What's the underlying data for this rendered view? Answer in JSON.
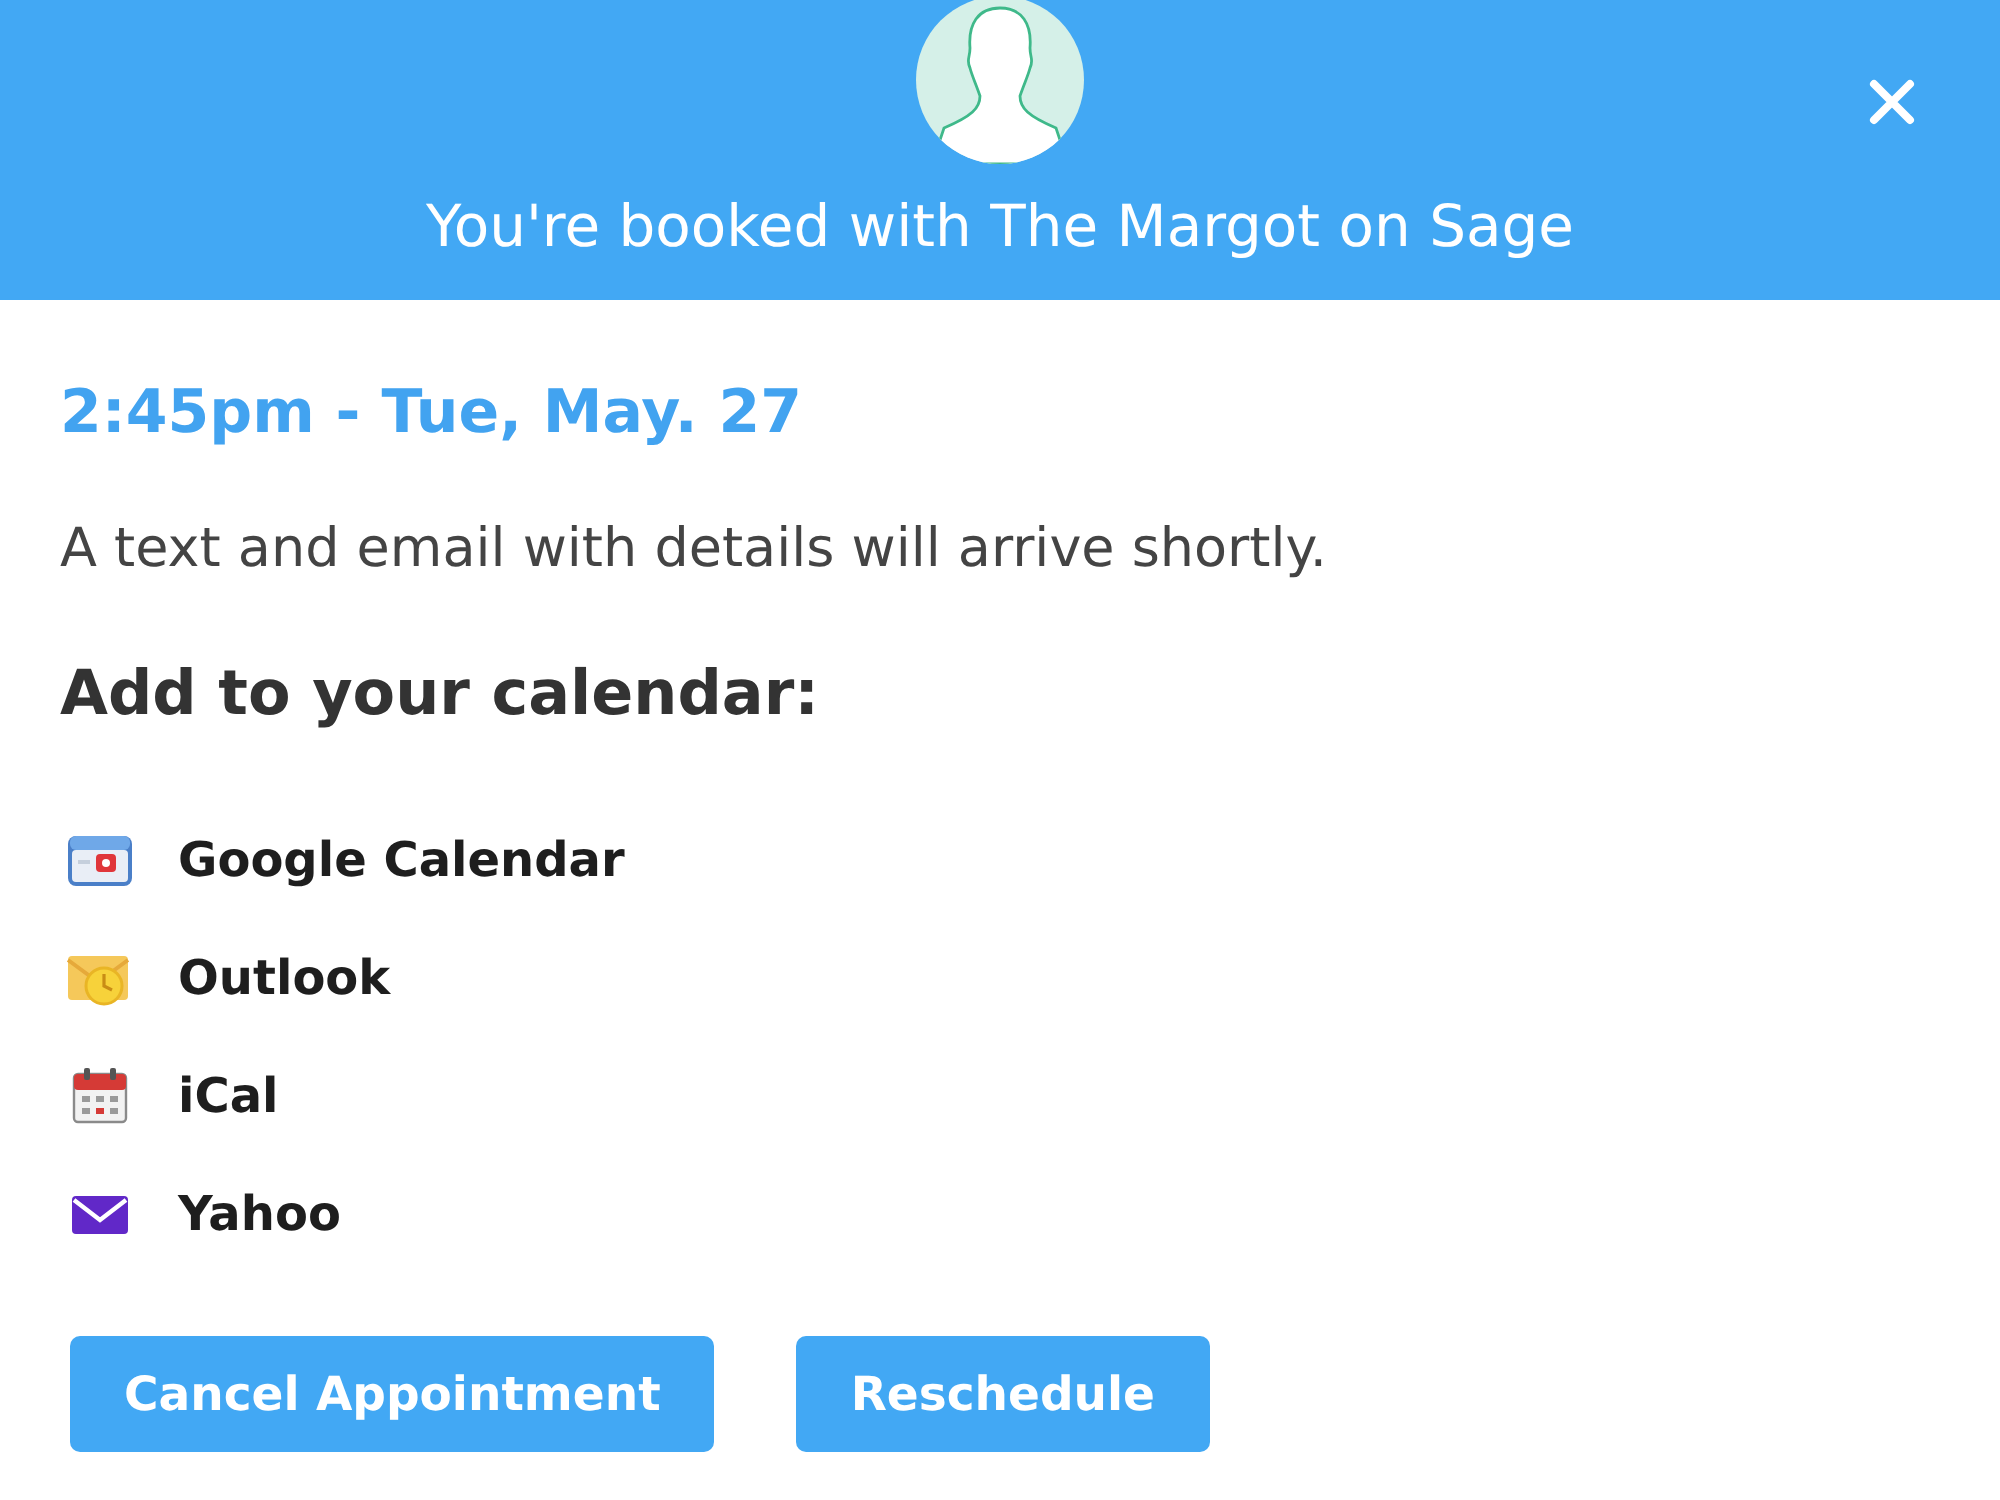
{
  "header": {
    "title": "You're booked with The Margot on Sage"
  },
  "appointment": {
    "time": "2:45pm - Tue, May. 27",
    "note": "A text and email with details will arrive shortly."
  },
  "calendar": {
    "heading": "Add to your calendar:",
    "options": [
      {
        "label": "Google Calendar"
      },
      {
        "label": "Outlook"
      },
      {
        "label": "iCal"
      },
      {
        "label": "Yahoo"
      }
    ]
  },
  "buttons": [
    {
      "label": "Cancel Appointment"
    },
    {
      "label": "Reschedule"
    }
  ]
}
